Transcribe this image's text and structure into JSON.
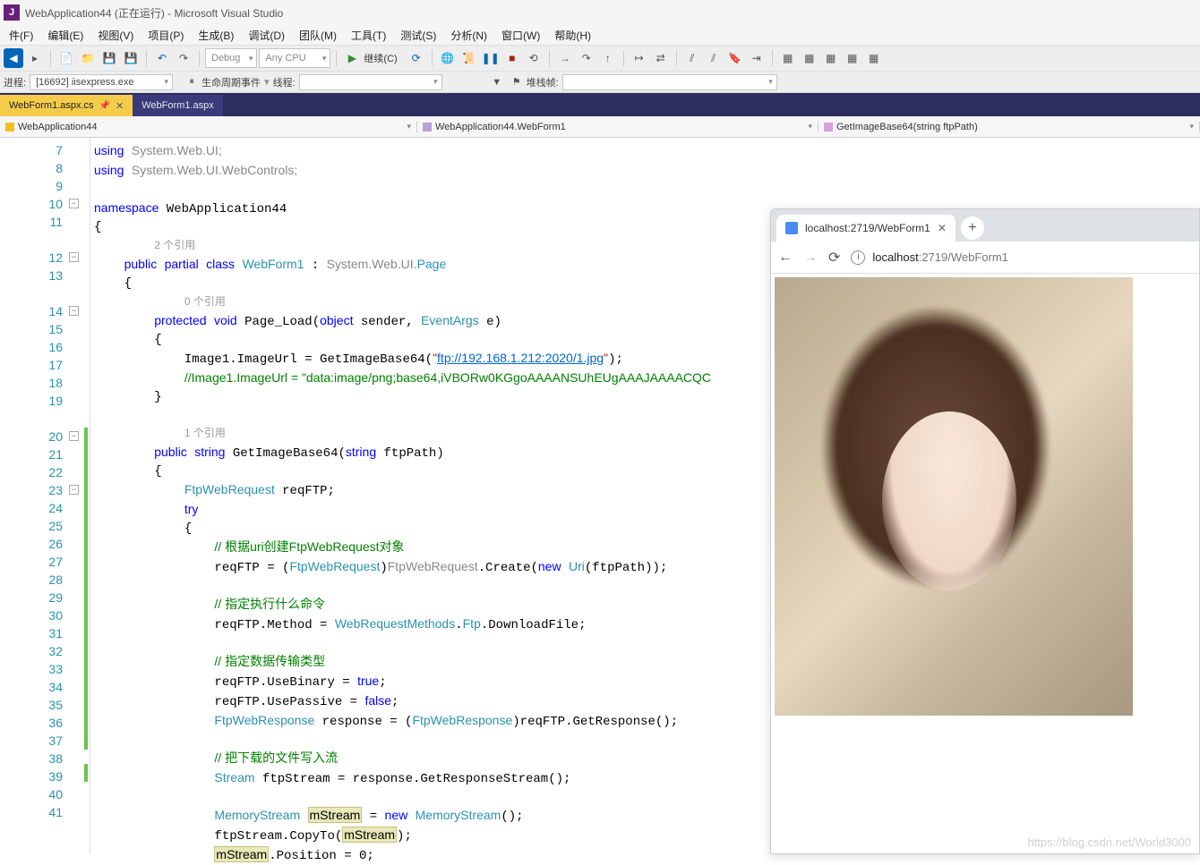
{
  "title": "WebApplication44 (正在运行) - Microsoft Visual Studio",
  "menu": [
    "件(F)",
    "编辑(E)",
    "视图(V)",
    "项目(P)",
    "生成(B)",
    "调试(D)",
    "团队(M)",
    "工具(T)",
    "测试(S)",
    "分析(N)",
    "窗口(W)",
    "帮助(H)"
  ],
  "toolbar": {
    "config": "Debug",
    "platform": "Any CPU",
    "continue": "继续(C)"
  },
  "toolbar2": {
    "process_label": "进程:",
    "process_value": "[16692] iisexpress.exe",
    "lifecycle_label": "生命周期事件",
    "thread_label": "线程:",
    "stackframe_label": "堆栈帧:"
  },
  "tabs": {
    "active": "WebForm1.aspx.cs",
    "inactive": "WebForm1.aspx"
  },
  "breadcrumb": {
    "project": "WebApplication44",
    "class": "WebApplication44.WebForm1",
    "method": "GetImageBase64(string ftpPath)"
  },
  "code": {
    "ref2": "2 个引用",
    "ref0": "0 个引用",
    "ref1": "1 个引用",
    "ftp_url": "ftp://192.168.1.212:2020/1.jpg",
    "comment_base64": "//Image1.ImageUrl = \"data:image/png;base64,iVBORw0KGgoAAAANSUhEUgAAAJAAAACQC",
    "c1": "// 根据uri创建FtpWebRequest对象",
    "c2": "// 指定执行什么命令",
    "c3": "// 指定数据传输类型",
    "c4": "// 把下载的文件写入流"
  },
  "browser": {
    "tab_title": "localhost:2719/WebForm1",
    "host": "localhost",
    "port_path": ":2719/WebForm1"
  },
  "watermark": "https://blog.csdn.net/World3000",
  "line_numbers": [
    7,
    8,
    9,
    10,
    11,
    "",
    12,
    13,
    "",
    14,
    15,
    16,
    17,
    18,
    19,
    "",
    20,
    21,
    22,
    23,
    24,
    25,
    26,
    27,
    28,
    29,
    30,
    31,
    32,
    33,
    34,
    35,
    36,
    37,
    38,
    39,
    40,
    41
  ]
}
